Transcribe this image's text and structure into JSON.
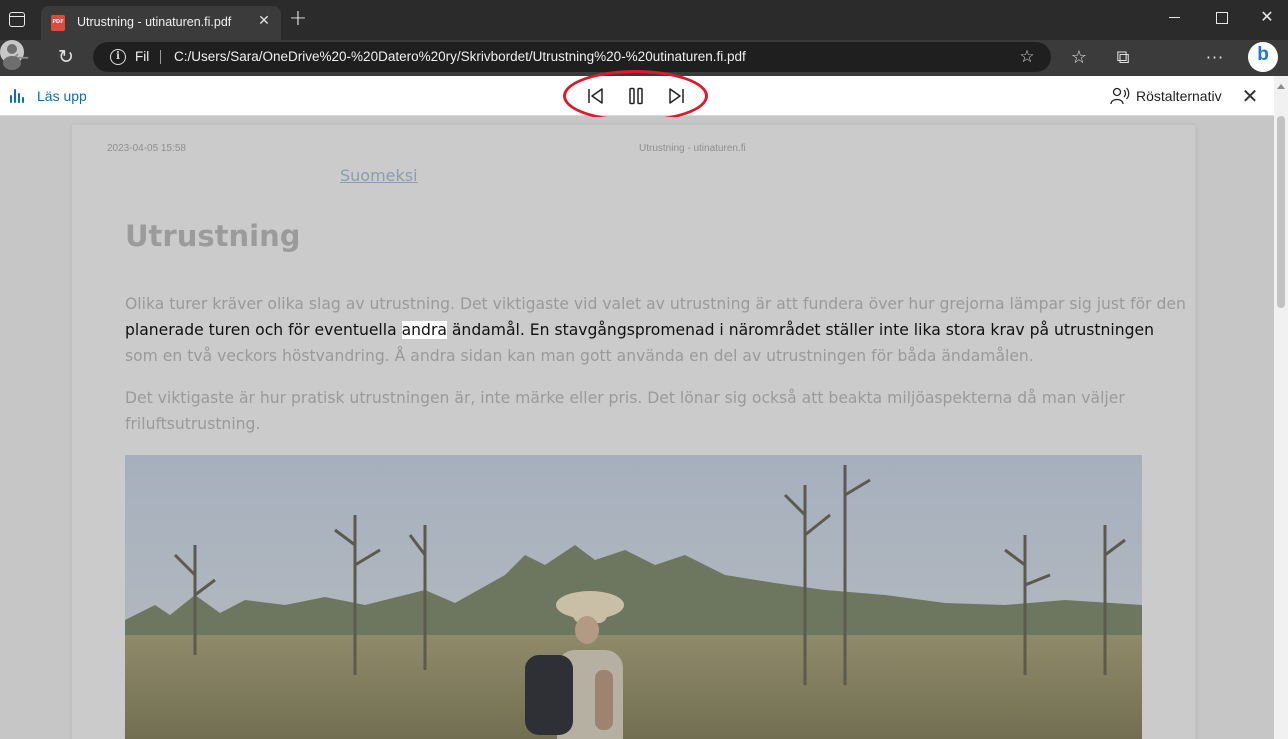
{
  "browser": {
    "tab": {
      "title": "Utrustning - utinaturen.fi.pdf",
      "close": "✕"
    },
    "new_tab": "+",
    "window": {
      "close": "✕"
    },
    "address": {
      "scheme_label": "Fil",
      "url": "C:/Users/Sara/OneDrive%20-%20Datero%20ry/Skrivbordet/Utrustning%20-%20utinaturen.fi.pdf"
    },
    "icons": {
      "back": "arrow-left-icon",
      "refresh": "refresh-icon",
      "favorites": "favorites-icon",
      "collections": "collections-icon",
      "profile": "profile-icon",
      "more": "more-icon",
      "bing": "bing-icon"
    }
  },
  "read_aloud": {
    "label": "Läs upp",
    "voice_options": "Röstalternativ",
    "close": "✕",
    "highlight_color": "#e0182a",
    "accent_color": "#0f6cbd"
  },
  "document": {
    "header_date": "2023-04-05 15:58",
    "header_site": "Utrustning - utinaturen.fi",
    "language_link": "Suomeksi",
    "title": "Utrustning",
    "paragraph1": {
      "line1": "Olika turer kräver olika slag av utrustning. Det viktigaste vid valet av utrustning är att fundera över hur grejorna lämpar sig just för den",
      "line2_before": "planerade turen och för eventuella ",
      "line2_highlight": "andra",
      "line2_after": " ändamål. En stavgångspromenad i närområdet ställer inte lika stora krav på utrustningen",
      "line3": "som en två veckors höstvandring. Å andra sidan kan man gott använda en del av utrustningen för båda ändamålen."
    },
    "paragraph2": {
      "line1": "Det viktigaste är hur pratisk utrustningen är, inte märke eller pris. Det lönar sig också att beakta miljöaspekterna då man väljer",
      "line2": "friluftsutrustning."
    }
  }
}
